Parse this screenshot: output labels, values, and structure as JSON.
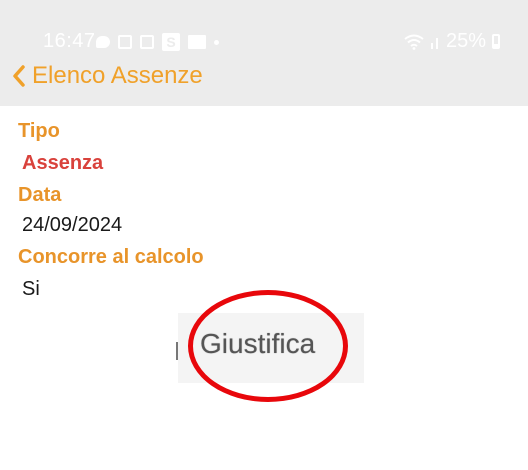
{
  "status_bar": {
    "time": "16:47",
    "battery_text": "25%",
    "battery_level": 0.25,
    "icons": [
      "chat-bubble-icon",
      "app-icon",
      "app-icon",
      "s-app-icon",
      "folder-icon",
      "notification-dot-icon",
      "wifi-icon",
      "signal-icon",
      "battery-icon"
    ]
  },
  "header": {
    "back_label": "Elenco Assenze"
  },
  "fields": {
    "tipo": {
      "label": "Tipo",
      "value": "Assenza"
    },
    "data": {
      "label": "Data",
      "value": "24/09/2024"
    },
    "calcolo": {
      "label": "Concorre al calcolo",
      "value": "Si"
    }
  },
  "actions": {
    "justify_label": "Giustifica"
  },
  "colors": {
    "accent": "#f0a12a",
    "label": "#e8942a",
    "value_highlight": "#d9423c",
    "annotation_ring": "#e8070b",
    "header_bg": "#ececec"
  }
}
